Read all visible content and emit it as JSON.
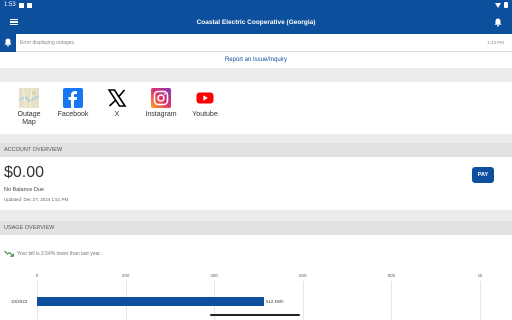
{
  "status_bar": {
    "time": "1:53",
    "icons": [
      "notification-icon",
      "sim-icon",
      "wifi-icon",
      "battery-icon"
    ]
  },
  "app_bar": {
    "title": "Coastal Electric Cooperative (Georgia)",
    "menu_icon": "menu-icon",
    "notification_icon": "bell-icon"
  },
  "alert": {
    "message": "Error displaying outages.",
    "time": "1:43 PM",
    "icon": "bell-icon"
  },
  "report_link": "Report an Issue/Inquiry",
  "social": [
    {
      "label": "Outage Map",
      "icon": "outage-map-icon"
    },
    {
      "label": "Facebook",
      "icon": "facebook-icon"
    },
    {
      "label": "X",
      "icon": "x-icon"
    },
    {
      "label": "Instagram",
      "icon": "instagram-icon"
    },
    {
      "label": "Youtube",
      "icon": "youtube-icon"
    }
  ],
  "account_overview": {
    "header": "ACCOUNT OVERVIEW",
    "amount": "$0.00",
    "balance_status": "No Balance Due",
    "updated": "Updated: Dec 27, 2024 1:51 PM",
    "pay_label": "PAY"
  },
  "usage_overview": {
    "header": "USAGE OVERVIEW",
    "trend_text": "Your bill is 2.54% lower than last year.",
    "trend_icon": "trend-down-icon"
  },
  "colors": {
    "brand": "#0c4f9c",
    "background": "#ececec",
    "section_header": "#e2e2e2"
  },
  "chart_data": {
    "type": "bar",
    "orientation": "horizontal",
    "x_ticks": [
      "0",
      "200",
      "400",
      "600",
      "800",
      "1k"
    ],
    "xlim": [
      0,
      1000
    ],
    "categories": [
      "10/2023"
    ],
    "values": [
      512
    ],
    "value_labels": [
      "512 kWh"
    ],
    "grid": true
  }
}
